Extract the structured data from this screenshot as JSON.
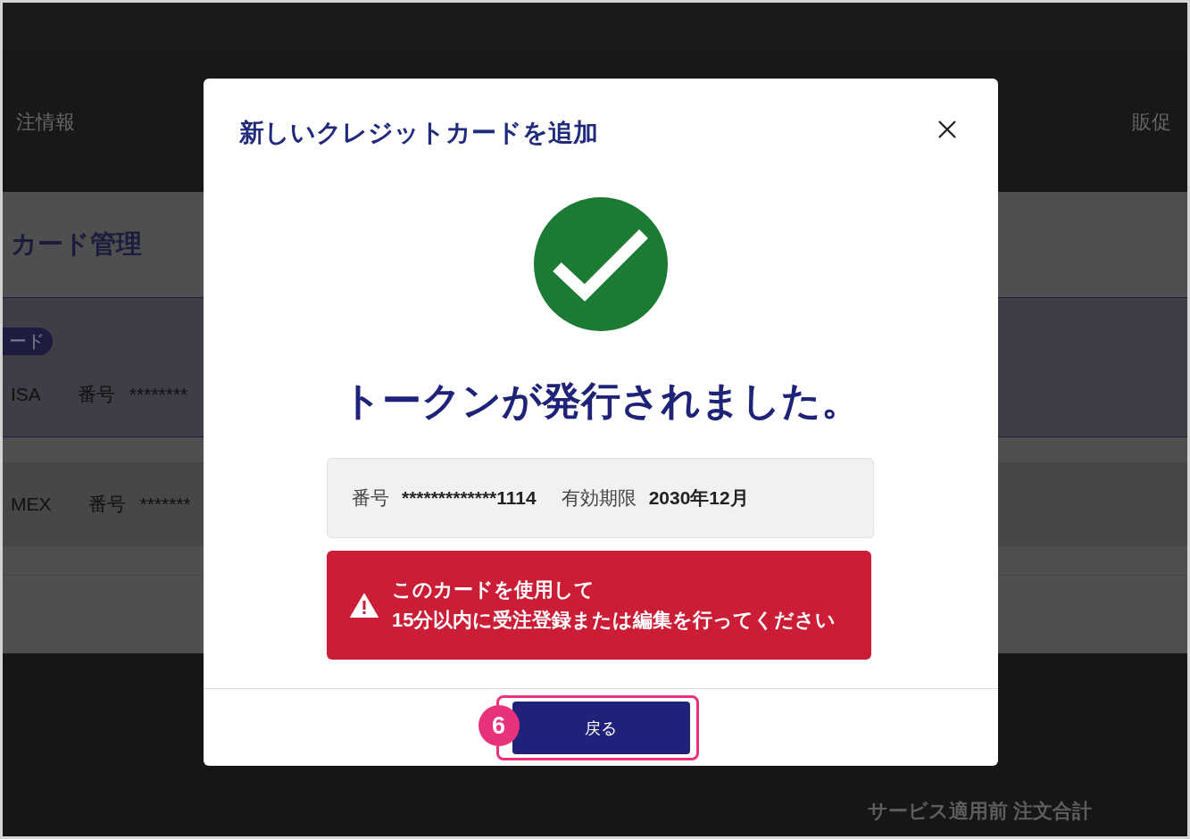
{
  "page": {
    "nav": {
      "left_item": "注情報",
      "right_item": "販促"
    },
    "title": "カード管理",
    "cards": [
      {
        "tag": "ード",
        "brand": "ISA",
        "number_label": "番号",
        "number": "********",
        "selected": true
      },
      {
        "brand": "MEX",
        "number_label": "番号",
        "number": "*******",
        "selected": false
      }
    ],
    "summary": "サービス適用前 注文合計"
  },
  "dialog": {
    "title": "新しいクレジットカードを追加",
    "message": "トークンが発行されました。",
    "card_info": [
      {
        "label": "番号",
        "value": "*************1114"
      },
      {
        "label": "有効期限",
        "value": "2030年12月"
      }
    ],
    "alert": {
      "kind": "error",
      "text": "このカードを使用して\n15分以内に受注登録または編集を行ってください"
    },
    "footer_button": {
      "label": "戻る"
    }
  },
  "annotation": {
    "number": "6"
  }
}
